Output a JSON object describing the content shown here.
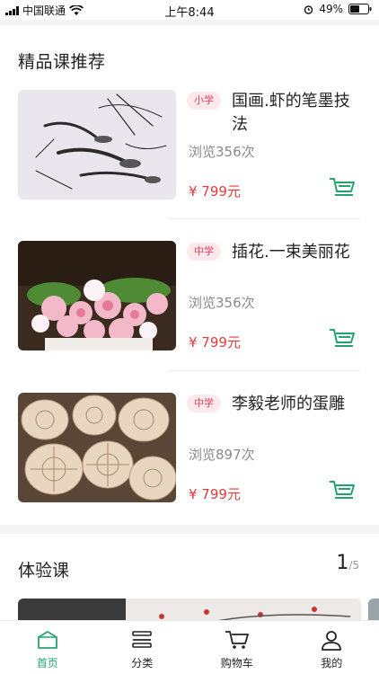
{
  "status_bar": {
    "carrier": "中国联通",
    "time": "上午8:44",
    "battery": "49%"
  },
  "featured": {
    "title": "精品课推荐",
    "courses": [
      {
        "tag": "小学",
        "title": "国画.虾的笔墨技法",
        "views": "浏览356次",
        "price": "¥ 799元"
      },
      {
        "tag": "中学",
        "title": "插花.一束美丽花",
        "views": "浏览356次",
        "price": "¥ 799元"
      },
      {
        "tag": "中学",
        "title": "李毅老师的蛋雕",
        "views": "浏览897次",
        "price": "¥ 799元"
      }
    ]
  },
  "experience": {
    "title": "体验课",
    "page_current": "1",
    "page_total": "/5"
  },
  "tabbar": {
    "tabs": [
      {
        "label": "首页",
        "icon": "home-icon"
      },
      {
        "label": "分类",
        "icon": "category-icon"
      },
      {
        "label": "购物车",
        "icon": "cart-icon"
      },
      {
        "label": "我的",
        "icon": "user-icon"
      }
    ]
  },
  "colors": {
    "accent": "#25a36f",
    "price": "#e23b3b",
    "tag_text": "#e0405a",
    "tag_bg": "#fde9ec"
  }
}
